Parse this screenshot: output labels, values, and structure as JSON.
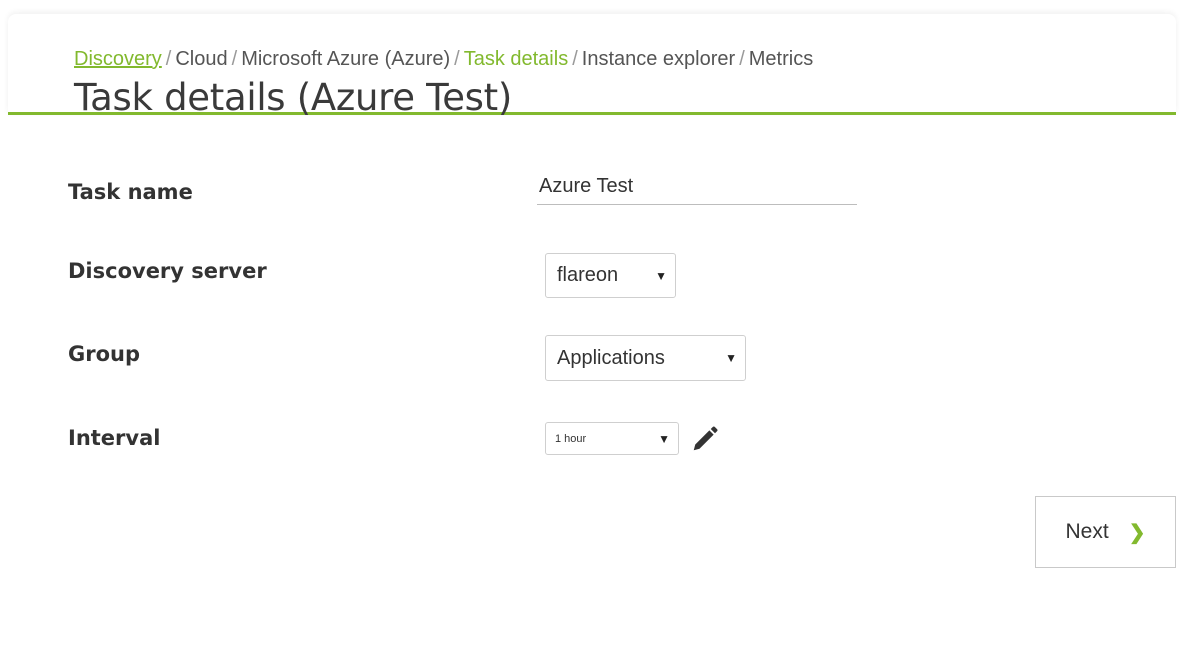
{
  "breadcrumb": {
    "items": [
      {
        "label": "Discovery",
        "style": "link-underline"
      },
      {
        "label": "Cloud",
        "style": "plain"
      },
      {
        "label": "Microsoft Azure (Azure)",
        "style": "plain"
      },
      {
        "label": "Task details",
        "style": "link"
      },
      {
        "label": "Instance explorer",
        "style": "plain"
      },
      {
        "label": "Metrics",
        "style": "plain"
      }
    ],
    "separator": "/"
  },
  "page_title": "Task details (Azure Test)",
  "form": {
    "task_name": {
      "label": "Task name",
      "value": "Azure Test"
    },
    "discovery_server": {
      "label": "Discovery server",
      "selected": "flareon"
    },
    "group": {
      "label": "Group",
      "selected": "Applications"
    },
    "interval": {
      "label": "Interval",
      "selected": "1 hour"
    }
  },
  "icons": {
    "dropdown_caret": "▼",
    "edit": "pencil-icon",
    "next": "chevron-right-icon"
  },
  "buttons": {
    "next_label": "Next"
  },
  "colors": {
    "accent": "#82b92e",
    "text": "#333333"
  }
}
